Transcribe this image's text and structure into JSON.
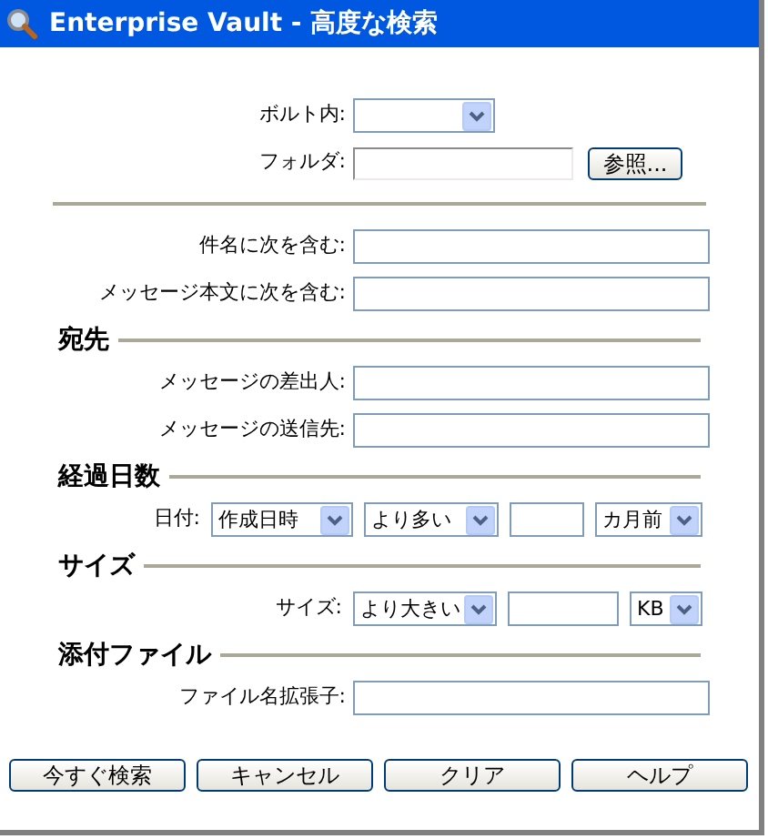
{
  "window": {
    "title": "Enterprise Vault - 高度な検索"
  },
  "location": [
    {
      "label": "ボルト内:",
      "controls": [
        {
          "kind": "select"
        }
      ]
    },
    {
      "label": "フォルダ:",
      "controls": [
        {
          "kind": "inset"
        },
        {
          "kind": "button",
          "label": "参照..."
        }
      ]
    }
  ],
  "sections": [
    {
      "rows": [
        {
          "kind": "field",
          "label": "件名に次を含む:",
          "controls": [
            {
              "kind": "text"
            }
          ]
        },
        {
          "kind": "field",
          "label": "メッセージ本文に次を含む:",
          "controls": [
            {
              "kind": "text"
            }
          ]
        }
      ]
    },
    {
      "heading": "宛先",
      "rows": [
        {
          "kind": "field",
          "label": "メッセージの差出人:",
          "controls": [
            {
              "kind": "text"
            }
          ]
        },
        {
          "kind": "field",
          "label": "メッセージの送信先:",
          "controls": [
            {
              "kind": "text"
            }
          ]
        }
      ]
    },
    {
      "heading": "経過日数",
      "rows": [
        {
          "kind": "criteria",
          "label": "日付:",
          "controls": [
            {
              "kind": "select",
              "value": "作成日時"
            },
            {
              "kind": "select",
              "value": "より多い"
            },
            {
              "kind": "text"
            },
            {
              "kind": "select",
              "value": "カ月前"
            }
          ]
        }
      ]
    },
    {
      "heading": "サイズ",
      "rows": [
        {
          "kind": "criteria",
          "label": "サイズ:",
          "controls": [
            {
              "kind": "select",
              "value": "より大きい"
            },
            {
              "kind": "text"
            },
            {
              "kind": "select",
              "value": "KB"
            }
          ]
        }
      ]
    },
    {
      "heading": "添付ファイル",
      "rows": [
        {
          "kind": "field",
          "label": "ファイル名拡張子:",
          "controls": [
            {
              "kind": "text"
            }
          ]
        }
      ]
    }
  ],
  "buttons": [
    "今すぐ検索",
    "キャンセル",
    "クリア",
    "ヘルプ"
  ]
}
